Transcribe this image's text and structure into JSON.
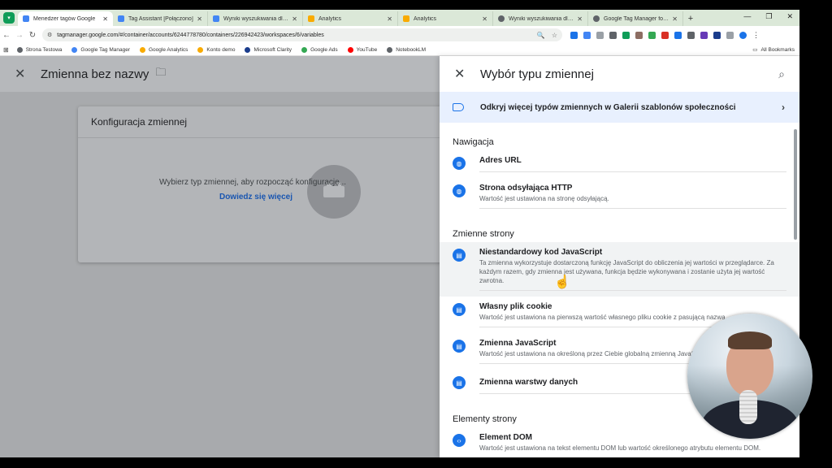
{
  "browser": {
    "tabs": [
      {
        "title": "Menedżer tagów Google",
        "color": "#4285f4",
        "active": true
      },
      {
        "title": "Tag Assistant [Połączono]",
        "color": "#4285f4"
      },
      {
        "title": "Wyniki wyszukiwania dla „wafe",
        "color": "#4285f4"
      },
      {
        "title": "Analytics",
        "color": "#f9ab00"
      },
      {
        "title": "Analytics",
        "color": "#f9ab00"
      },
      {
        "title": "Wyniki wyszukiwania dla „frazy",
        "color": "#5f6368"
      },
      {
        "title": "Google Tag Manager for Word",
        "color": "#5f6368"
      }
    ],
    "url": "tagmanager.google.com/#/container/accounts/6244778780/containers/226942423/workspaces/6/variables",
    "bookmarks": [
      {
        "label": "Strona Testowa",
        "color": "#5f6368"
      },
      {
        "label": "Google Tag Manager",
        "color": "#4285f4"
      },
      {
        "label": "Google Analytics",
        "color": "#f9ab00"
      },
      {
        "label": "Konto demo",
        "color": "#f9ab00"
      },
      {
        "label": "Microsoft Clarity",
        "color": "#1a3c8c"
      },
      {
        "label": "Google Ads",
        "color": "#34a853"
      },
      {
        "label": "YouTube",
        "color": "#ff0000"
      },
      {
        "label": "NotebookLM",
        "color": "#5f6368"
      }
    ],
    "all_bookmarks": "All Bookmarks"
  },
  "left": {
    "variable_name": "Zmienna bez nazwy",
    "card_title": "Konfiguracja zmiennej",
    "prompt": "Wybierz typ zmiennej, aby rozpocząć konfigurację...",
    "learn_more": "Dowiedz się więcej"
  },
  "panel": {
    "title": "Wybór typu zmiennej",
    "gallery": "Odkryj więcej typów zmiennych w Galerii szablonów społeczności",
    "sections": {
      "nav": "Nawigacja",
      "page_vars": "Zmienne strony",
      "page_elements": "Elementy strony"
    },
    "items": {
      "url": {
        "name": "Adres URL",
        "desc": ""
      },
      "referrer": {
        "name": "Strona odsyłająca HTTP",
        "desc": "Wartość jest ustawiona na stronę odsyłającą."
      },
      "custom_js": {
        "name": "Niestandardowy kod JavaScript",
        "desc": "Ta zmienna wykorzystuje dostarczoną funkcję JavaScript do obliczenia jej wartości w przeglądarce. Za każdym razem, gdy zmienna jest używana, funkcja będzie wykonywana i zostanie użyta jej wartość zwrotna."
      },
      "cookie": {
        "name": "Własny plik cookie",
        "desc": "Wartość jest ustawiona na pierwszą wartość własnego pliku cookie z pasującą nazwą."
      },
      "js_var": {
        "name": "Zmienna JavaScript",
        "desc": "Wartość jest ustawiona na określoną przez Ciebie globalną zmienną JavaScript."
      },
      "datalayer": {
        "name": "Zmienna warstwy danych",
        "desc": ""
      },
      "dom": {
        "name": "Element DOM",
        "desc": "Wartość jest ustawiona na tekst elementu DOM lub wartość określonego atrybutu elementu DOM."
      }
    }
  }
}
